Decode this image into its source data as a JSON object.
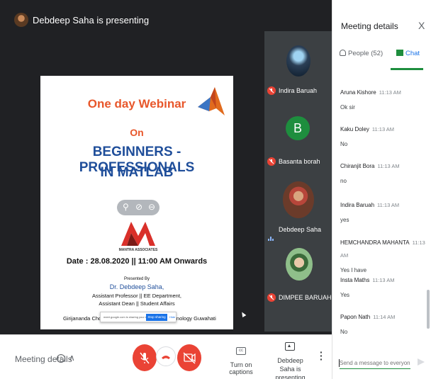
{
  "presenter_banner": "Debdeep Saha is presenting",
  "slide": {
    "title": "One day Webinar",
    "on": "On",
    "main_line1": "BEGINNERS - PROFESSIONALS",
    "main_line2": "IN MATLAB",
    "logo_text": "MANTRA ASSOCIATES",
    "date": "Date : 28.08.2020 || 11:00 AM Onwards",
    "presented_by": "Presented By",
    "presenter": "Dr. Debdeep Saha,",
    "line1": "Assistant Professor || EE Department,",
    "line2": "Assistant Dean || Student Affairs",
    "line3_left": "Girijananda Chow",
    "line3_right": "chnology Guwahati",
    "share_bar_text": "meet.google.com is sharing your screen.",
    "stop_sharing": "Stop sharing",
    "hide": "Hide"
  },
  "tiles": [
    {
      "name": "Indira Baruah"
    },
    {
      "name": "Basanta borah",
      "initial": "B"
    },
    {
      "name": "Debdeep Saha"
    },
    {
      "name": "DIMPEE BARUAH"
    }
  ],
  "toolbar": {
    "meeting_details": "Meeting details",
    "captions": "Turn on captions",
    "presenting": "Debdeep Saha is presenting"
  },
  "panel": {
    "title": "Meeting details",
    "close": "X",
    "tab_people": "People (52)",
    "tab_chat": "Chat",
    "messages": [
      {
        "sender": "Aruna Kishore",
        "time": "11:13 AM",
        "text": "Ok sir"
      },
      {
        "sender": "Kaku Doley",
        "time": "11:13 AM",
        "text": "No"
      },
      {
        "sender": "Chiranjit Bora",
        "time": "11:13 AM",
        "text": "no"
      },
      {
        "sender": "Indira Baruah",
        "time": "11:13 AM",
        "text": "yes"
      },
      {
        "sender": "HEMCHANDRA MAHANTA",
        "time": "11:13 AM",
        "text": "Yes I have"
      },
      {
        "sender": "Insta Maths",
        "time": "11:13 AM",
        "text": "Yes"
      },
      {
        "sender": "Papon Nath",
        "time": "11:14 AM",
        "text": "No"
      }
    ],
    "input_placeholder": "Send a message to everyone"
  },
  "colors": {
    "accent_green": "#1e8e3e",
    "danger_red": "#ea4335",
    "stage_bg": "#202124"
  }
}
